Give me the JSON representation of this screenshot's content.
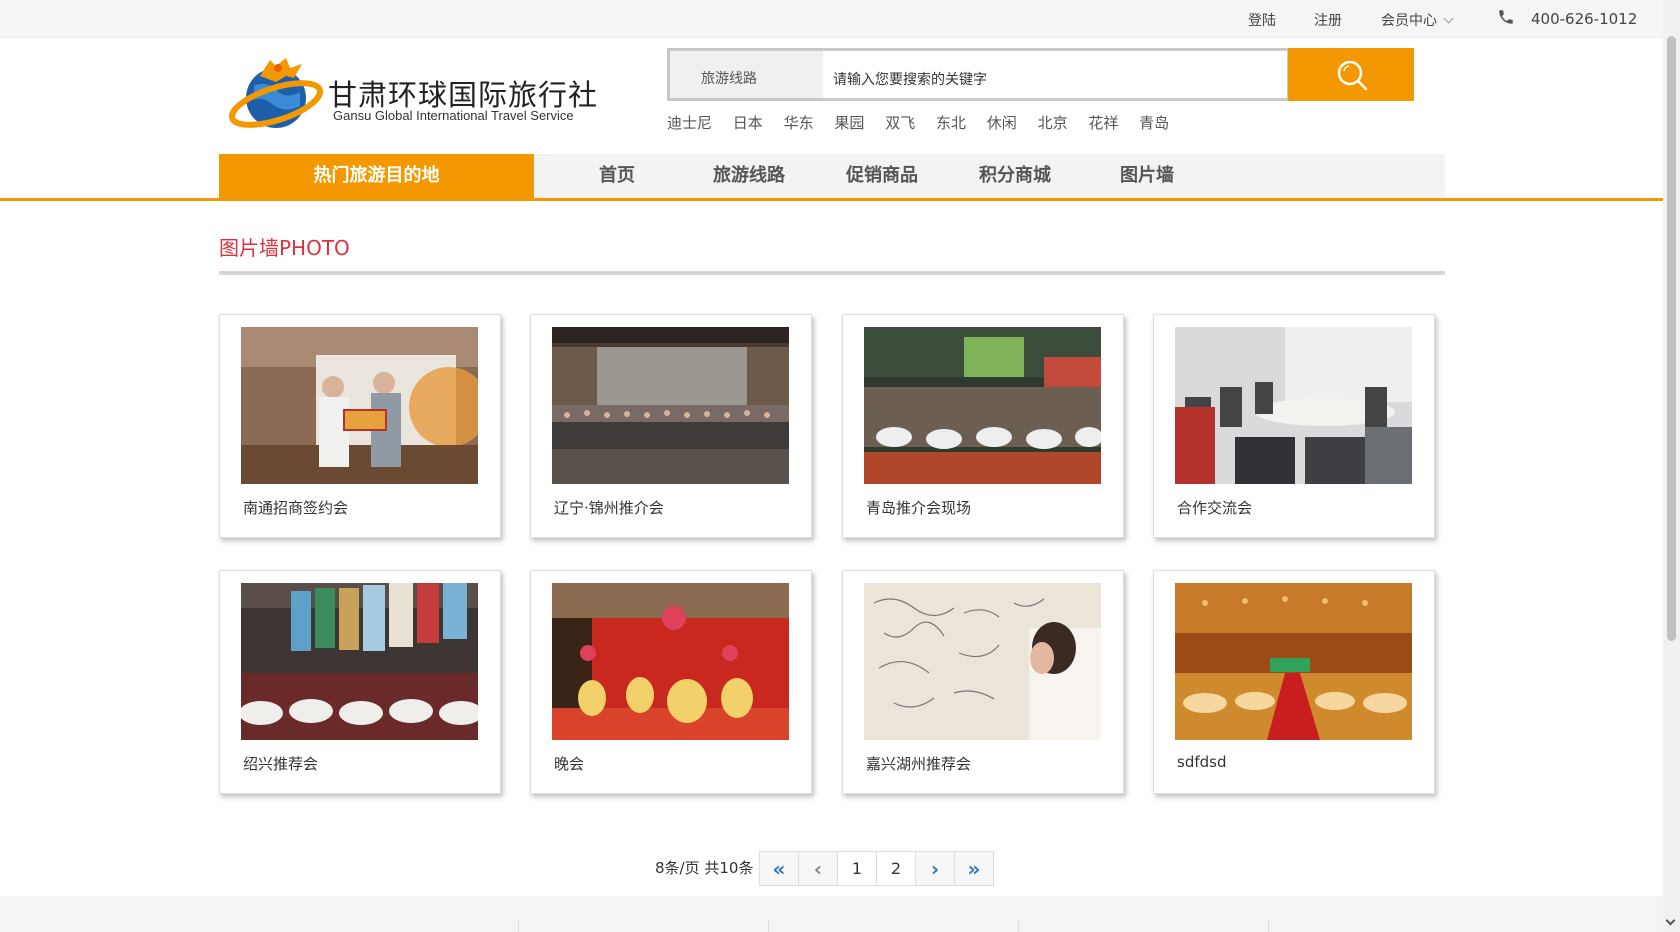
{
  "topbar": {
    "login": "登陆",
    "register": "注册",
    "member_center": "会员中心",
    "phone": "400-626-1012"
  },
  "logo": {
    "cn": "甘肃环球国际旅行社",
    "en": "Gansu Global International Travel Service"
  },
  "search": {
    "category": "旅游线路",
    "placeholder": "请输入您要搜索的关键字",
    "hotwords": [
      "迪士尼",
      "日本",
      "华东",
      "果园",
      "双飞",
      "东北",
      "休闲",
      "北京",
      "花祥",
      "青岛"
    ]
  },
  "nav": {
    "hot": "热门旅游目的地",
    "items": [
      "首页",
      "旅游线路",
      "促销商品",
      "积分商城",
      "图片墙"
    ]
  },
  "section": {
    "title": "图片墙PHOTO"
  },
  "photos": [
    {
      "caption": "南通招商签约会"
    },
    {
      "caption": "辽宁·锦州推介会"
    },
    {
      "caption": "青岛推介会现场"
    },
    {
      "caption": "合作交流会"
    },
    {
      "caption": "绍兴推荐会"
    },
    {
      "caption": "晚会"
    },
    {
      "caption": "嘉兴湖州推荐会"
    },
    {
      "caption": "sdfdsd"
    }
  ],
  "pagination": {
    "info": "8条/页 共10条",
    "pages": [
      "1",
      "2"
    ]
  },
  "colors": {
    "accent": "#f39800",
    "title_red": "#d9333f",
    "link_blue": "#337ab7"
  }
}
